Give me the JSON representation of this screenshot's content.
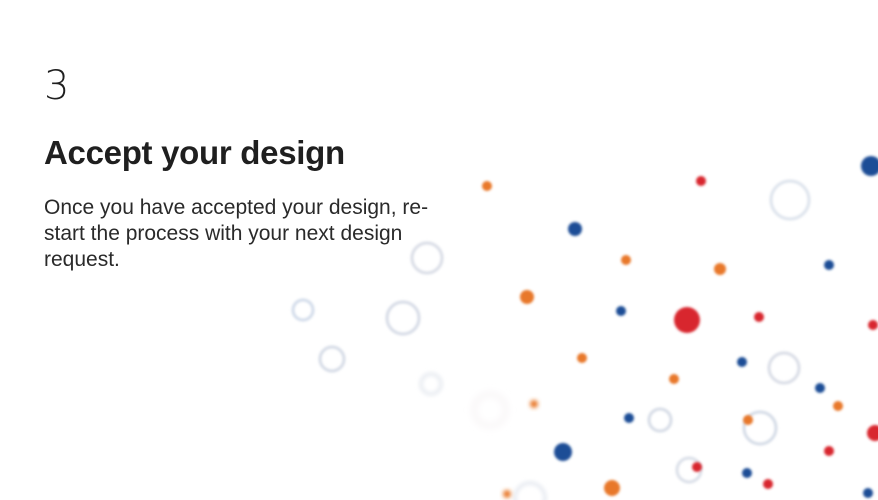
{
  "slide": {
    "step_number": "3",
    "title": "Accept your design",
    "body": "Once you have accepted your design, re-start the process with your next design request."
  },
  "colors": {
    "background": "#ffffff",
    "text": "#1f1f1f",
    "dot_blue": "#1f4e96",
    "dot_red": "#d8282f",
    "dot_orange": "#e8782b",
    "ring": "#cfd8e6"
  }
}
